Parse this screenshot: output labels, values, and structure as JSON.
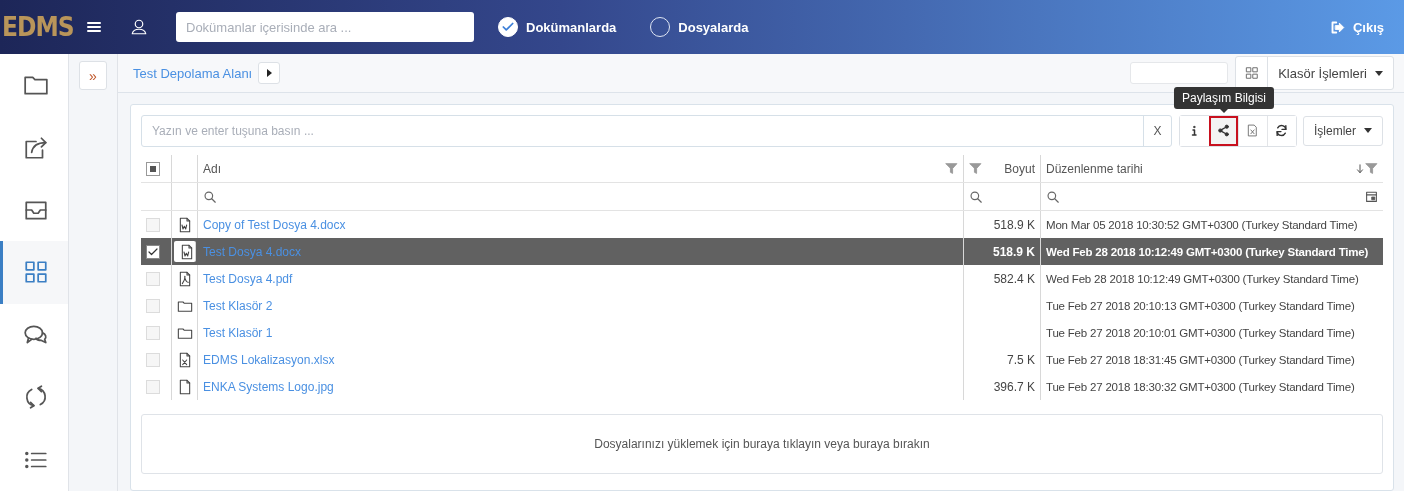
{
  "header": {
    "logo": "EDMS",
    "search": {
      "placeholder": "Dokümanlar içerisinde ara ..."
    },
    "scopes": [
      {
        "label": "Dokümanlarda",
        "selected": true
      },
      {
        "label": "Dosyalarda",
        "selected": false
      }
    ],
    "logout": "Çıkış"
  },
  "sidebar": {
    "items": [
      {
        "kind": "folder",
        "selected": false
      },
      {
        "kind": "share",
        "selected": false
      },
      {
        "kind": "inbox",
        "selected": false
      },
      {
        "kind": "grid",
        "selected": true
      },
      {
        "kind": "chat",
        "selected": false
      },
      {
        "kind": "sync",
        "selected": false
      },
      {
        "kind": "list",
        "selected": false
      }
    ]
  },
  "expand_button": "»",
  "breadcrumb": {
    "items": [
      "Test Depolama Alanı"
    ]
  },
  "folder_actions": "Klasör İşlemleri",
  "toolbar": {
    "filter": {
      "placeholder": "Yazın ve enter tuşuna basın ..."
    },
    "clear": "X",
    "buttons": [
      {
        "kind": "info",
        "highlighted": false
      },
      {
        "kind": "share",
        "highlighted": true
      },
      {
        "kind": "excel",
        "highlighted": false
      },
      {
        "kind": "refresh",
        "highlighted": false
      }
    ],
    "tooltip": "Paylaşım Bilgisi",
    "actions": "İşlemler"
  },
  "table": {
    "select_all_partial": true,
    "columns": [
      {
        "label": "Adı",
        "sorted": false
      },
      {
        "label": "Boyut",
        "sorted": false
      },
      {
        "label": "Düzenlenme tarihi",
        "sorted": true
      }
    ],
    "rows": [
      {
        "kind": "docx",
        "name": "Copy of Test Dosya 4.docx",
        "size": "518.9 K",
        "modified": "Mon Mar 05 2018 10:30:52 GMT+0300 (Turkey Standard Time)",
        "selected": false
      },
      {
        "kind": "docx",
        "name": "Test Dosya 4.docx",
        "size": "518.9 K",
        "modified": "Wed Feb 28 2018 10:12:49 GMT+0300 (Turkey Standard Time)",
        "selected": true
      },
      {
        "kind": "pdf",
        "name": "Test Dosya 4.pdf",
        "size": "582.4 K",
        "modified": "Wed Feb 28 2018 10:12:49 GMT+0300 (Turkey Standard Time)",
        "selected": false
      },
      {
        "kind": "folder",
        "name": "Test Klasör 2",
        "modified": "Tue Feb 27 2018 20:10:13 GMT+0300 (Turkey Standard Time)",
        "selected": false
      },
      {
        "kind": "folder",
        "name": "Test Klasör 1",
        "modified": "Tue Feb 27 2018 20:10:01 GMT+0300 (Turkey Standard Time)",
        "selected": false
      },
      {
        "kind": "xlsx",
        "name": "EDMS Lokalizasyon.xlsx",
        "size": "7.5 K",
        "modified": "Tue Feb 27 2018 18:31:45 GMT+0300 (Turkey Standard Time)",
        "selected": false
      },
      {
        "kind": "file",
        "name": "ENKA Systems Logo.jpg",
        "size": "396.7 K",
        "modified": "Tue Feb 27 2018 18:30:32 GMT+0300 (Turkey Standard Time)",
        "selected": false
      }
    ]
  },
  "dropzone": "Dosyalarınızı yüklemek için buraya tıklayın veya buraya bırakın"
}
